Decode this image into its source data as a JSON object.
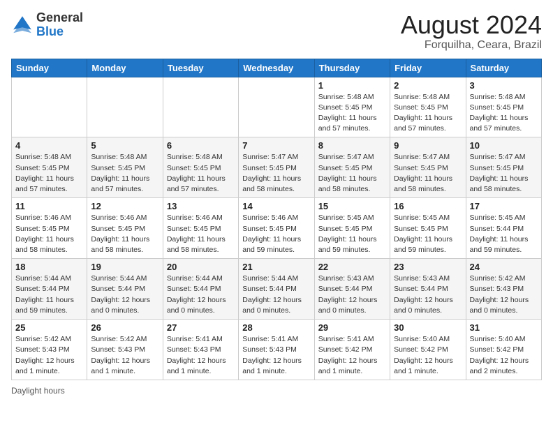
{
  "header": {
    "logo": {
      "general": "General",
      "blue": "Blue"
    },
    "title": "August 2024",
    "location": "Forquilha, Ceara, Brazil"
  },
  "days_of_week": [
    "Sunday",
    "Monday",
    "Tuesday",
    "Wednesday",
    "Thursday",
    "Friday",
    "Saturday"
  ],
  "weeks": [
    [
      {
        "day": "",
        "info": ""
      },
      {
        "day": "",
        "info": ""
      },
      {
        "day": "",
        "info": ""
      },
      {
        "day": "",
        "info": ""
      },
      {
        "day": "1",
        "info": "Sunrise: 5:48 AM\nSunset: 5:45 PM\nDaylight: 11 hours\nand 57 minutes."
      },
      {
        "day": "2",
        "info": "Sunrise: 5:48 AM\nSunset: 5:45 PM\nDaylight: 11 hours\nand 57 minutes."
      },
      {
        "day": "3",
        "info": "Sunrise: 5:48 AM\nSunset: 5:45 PM\nDaylight: 11 hours\nand 57 minutes."
      }
    ],
    [
      {
        "day": "4",
        "info": "Sunrise: 5:48 AM\nSunset: 5:45 PM\nDaylight: 11 hours\nand 57 minutes."
      },
      {
        "day": "5",
        "info": "Sunrise: 5:48 AM\nSunset: 5:45 PM\nDaylight: 11 hours\nand 57 minutes."
      },
      {
        "day": "6",
        "info": "Sunrise: 5:48 AM\nSunset: 5:45 PM\nDaylight: 11 hours\nand 57 minutes."
      },
      {
        "day": "7",
        "info": "Sunrise: 5:47 AM\nSunset: 5:45 PM\nDaylight: 11 hours\nand 58 minutes."
      },
      {
        "day": "8",
        "info": "Sunrise: 5:47 AM\nSunset: 5:45 PM\nDaylight: 11 hours\nand 58 minutes."
      },
      {
        "day": "9",
        "info": "Sunrise: 5:47 AM\nSunset: 5:45 PM\nDaylight: 11 hours\nand 58 minutes."
      },
      {
        "day": "10",
        "info": "Sunrise: 5:47 AM\nSunset: 5:45 PM\nDaylight: 11 hours\nand 58 minutes."
      }
    ],
    [
      {
        "day": "11",
        "info": "Sunrise: 5:46 AM\nSunset: 5:45 PM\nDaylight: 11 hours\nand 58 minutes."
      },
      {
        "day": "12",
        "info": "Sunrise: 5:46 AM\nSunset: 5:45 PM\nDaylight: 11 hours\nand 58 minutes."
      },
      {
        "day": "13",
        "info": "Sunrise: 5:46 AM\nSunset: 5:45 PM\nDaylight: 11 hours\nand 58 minutes."
      },
      {
        "day": "14",
        "info": "Sunrise: 5:46 AM\nSunset: 5:45 PM\nDaylight: 11 hours\nand 59 minutes."
      },
      {
        "day": "15",
        "info": "Sunrise: 5:45 AM\nSunset: 5:45 PM\nDaylight: 11 hours\nand 59 minutes."
      },
      {
        "day": "16",
        "info": "Sunrise: 5:45 AM\nSunset: 5:45 PM\nDaylight: 11 hours\nand 59 minutes."
      },
      {
        "day": "17",
        "info": "Sunrise: 5:45 AM\nSunset: 5:44 PM\nDaylight: 11 hours\nand 59 minutes."
      }
    ],
    [
      {
        "day": "18",
        "info": "Sunrise: 5:44 AM\nSunset: 5:44 PM\nDaylight: 11 hours\nand 59 minutes."
      },
      {
        "day": "19",
        "info": "Sunrise: 5:44 AM\nSunset: 5:44 PM\nDaylight: 12 hours\nand 0 minutes."
      },
      {
        "day": "20",
        "info": "Sunrise: 5:44 AM\nSunset: 5:44 PM\nDaylight: 12 hours\nand 0 minutes."
      },
      {
        "day": "21",
        "info": "Sunrise: 5:44 AM\nSunset: 5:44 PM\nDaylight: 12 hours\nand 0 minutes."
      },
      {
        "day": "22",
        "info": "Sunrise: 5:43 AM\nSunset: 5:44 PM\nDaylight: 12 hours\nand 0 minutes."
      },
      {
        "day": "23",
        "info": "Sunrise: 5:43 AM\nSunset: 5:44 PM\nDaylight: 12 hours\nand 0 minutes."
      },
      {
        "day": "24",
        "info": "Sunrise: 5:42 AM\nSunset: 5:43 PM\nDaylight: 12 hours\nand 0 minutes."
      }
    ],
    [
      {
        "day": "25",
        "info": "Sunrise: 5:42 AM\nSunset: 5:43 PM\nDaylight: 12 hours\nand 1 minute."
      },
      {
        "day": "26",
        "info": "Sunrise: 5:42 AM\nSunset: 5:43 PM\nDaylight: 12 hours\nand 1 minute."
      },
      {
        "day": "27",
        "info": "Sunrise: 5:41 AM\nSunset: 5:43 PM\nDaylight: 12 hours\nand 1 minute."
      },
      {
        "day": "28",
        "info": "Sunrise: 5:41 AM\nSunset: 5:43 PM\nDaylight: 12 hours\nand 1 minute."
      },
      {
        "day": "29",
        "info": "Sunrise: 5:41 AM\nSunset: 5:42 PM\nDaylight: 12 hours\nand 1 minute."
      },
      {
        "day": "30",
        "info": "Sunrise: 5:40 AM\nSunset: 5:42 PM\nDaylight: 12 hours\nand 1 minute."
      },
      {
        "day": "31",
        "info": "Sunrise: 5:40 AM\nSunset: 5:42 PM\nDaylight: 12 hours\nand 2 minutes."
      }
    ]
  ],
  "footer": {
    "note": "Daylight hours"
  }
}
